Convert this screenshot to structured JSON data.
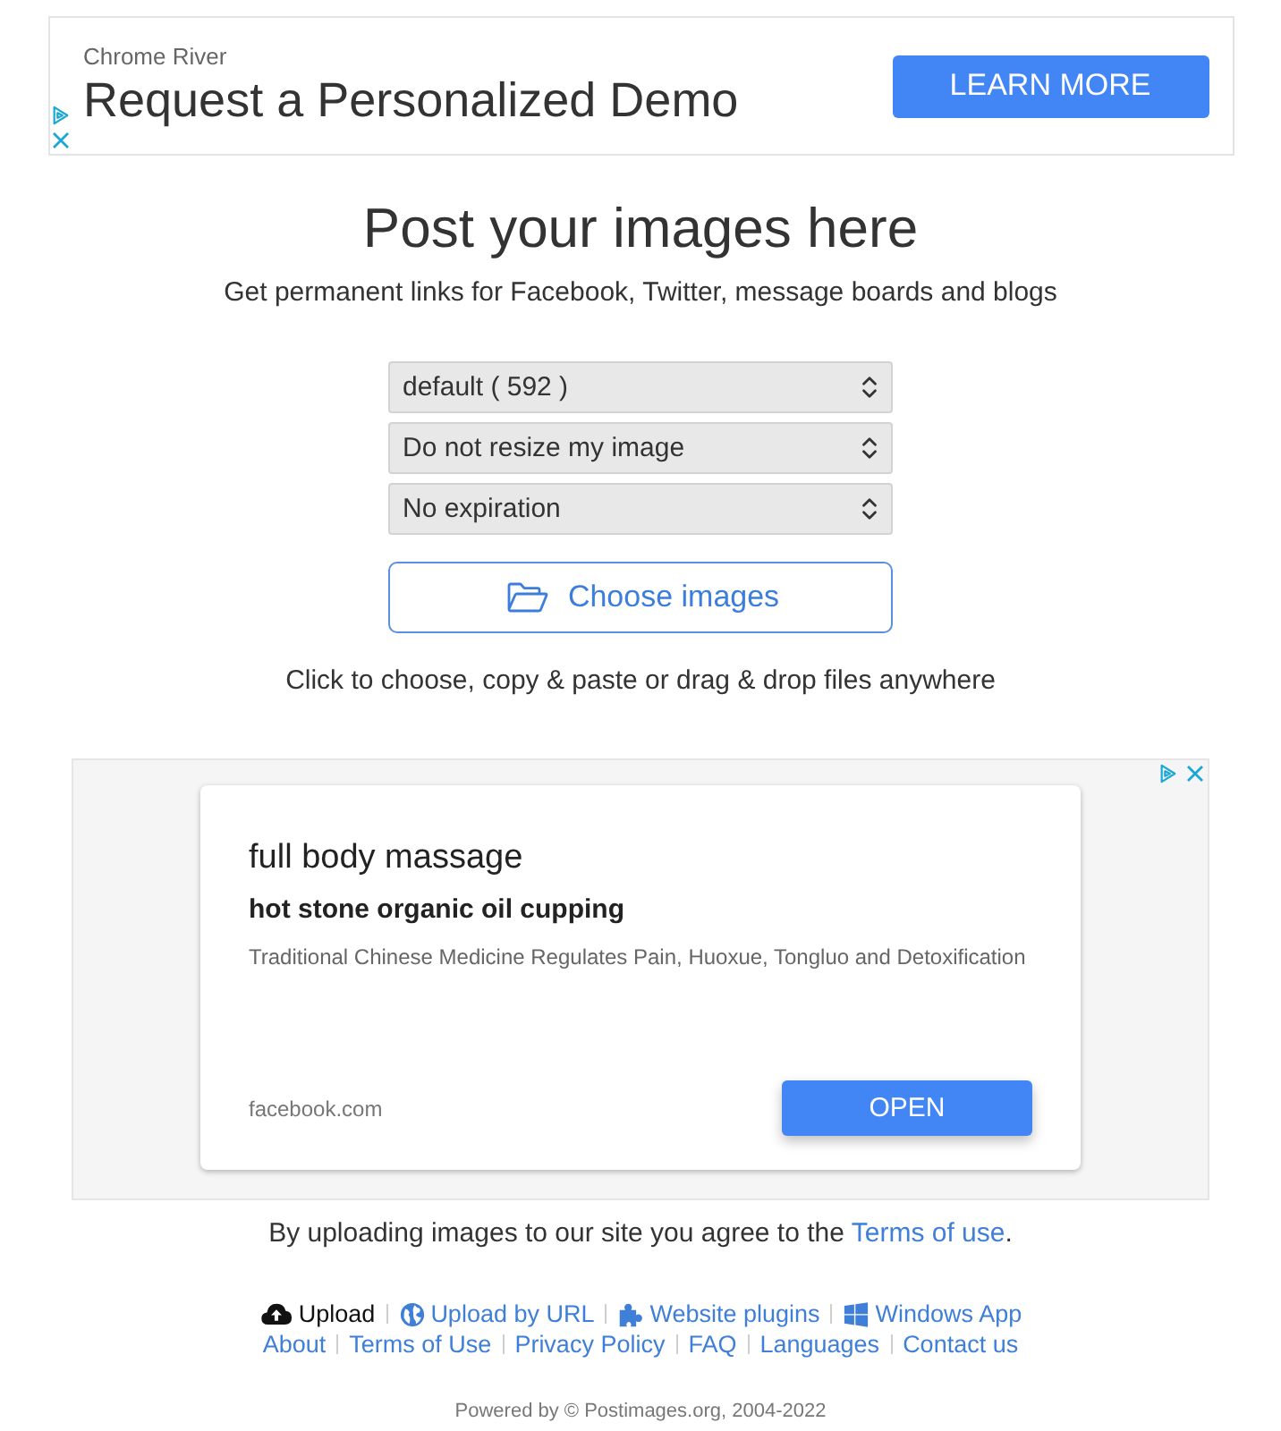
{
  "top_ad": {
    "advertiser": "Chrome River",
    "headline": "Request a Personalized Demo",
    "button": "LEARN MORE"
  },
  "header": {
    "title": "Post your images here",
    "subtitle": "Get permanent links for Facebook, Twitter, message boards and blogs"
  },
  "options": [
    {
      "value": "default ( 592 )"
    },
    {
      "value": "Do not resize my image"
    },
    {
      "value": "No expiration"
    }
  ],
  "upload_button": {
    "label": "Choose images"
  },
  "hint": "Click to choose, copy & paste or drag & drop files anywhere",
  "card_ad": {
    "headline": "full body massage",
    "subheadline": "hot stone organic oil cupping",
    "description": "Traditional Chinese Medicine Regulates Pain, Huoxue, Tongluo and Detoxification",
    "domain": "facebook.com",
    "button": "OPEN"
  },
  "terms": {
    "text_before": "By uploading images to our site you agree to the ",
    "link": "Terms of use",
    "text_after": "."
  },
  "nav_links": [
    {
      "label": "Upload",
      "selected": true
    },
    {
      "label": "Upload by URL",
      "selected": false
    },
    {
      "label": "Website plugins",
      "selected": false
    },
    {
      "label": "Windows App",
      "selected": false
    }
  ],
  "footer_links": [
    {
      "label": "About"
    },
    {
      "label": "Terms of Use"
    },
    {
      "label": "Privacy Policy"
    },
    {
      "label": "FAQ"
    },
    {
      "label": "Languages"
    },
    {
      "label": "Contact us"
    }
  ],
  "copyright": "Powered by © Postimages.org, 2004-2022"
}
